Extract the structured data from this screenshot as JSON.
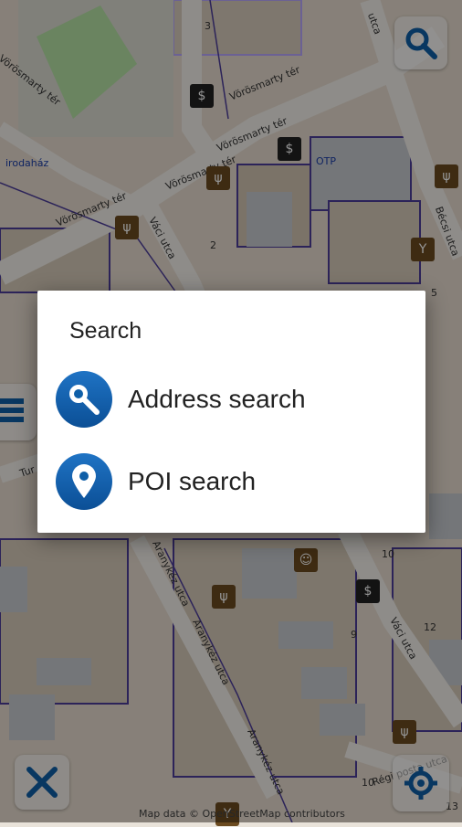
{
  "map": {
    "labels": {
      "vorosmarty_1": "Vörösmarty tér",
      "vorosmarty_2": "Vörösmarty tér",
      "vorosmarty_3": "Vörösmarty tér",
      "vorosmarty_4": "Vörösmarty tér",
      "vorosmarty_5": "Vörösmarty tér",
      "irodahaz": "irodaház",
      "otp": "OTP",
      "vaci_1": "Váci utca",
      "vaci_2": "Váci utca",
      "becsi": "Bécsi utca",
      "utca_top": "utca",
      "aranykez_1": "Aranykéz utca",
      "aranykez_2": "Aranykéz utca",
      "aranykez_3": "Aranykéz utca",
      "regi": "Régi posta utca",
      "tur": "Tur",
      "num_3": "3",
      "num_2": "2",
      "num_5": "5",
      "num_10a": "10",
      "num_12": "12",
      "num_9": "9",
      "num_10b": "10",
      "num_13": "13"
    },
    "copyright": "Map data © OpenStreetMap contributors"
  },
  "buttons": {
    "search": "search-icon",
    "menu": "list-icon",
    "close": "close-icon",
    "locate": "location-target-icon"
  },
  "dialog": {
    "title": "Search",
    "items": [
      {
        "label": "Address search",
        "icon": "magnifier-icon"
      },
      {
        "label": "POI search",
        "icon": "map-pin-icon"
      }
    ]
  },
  "colors": {
    "accent": "#0f5fa8",
    "overlay": "rgba(0,0,0,0.42)"
  }
}
